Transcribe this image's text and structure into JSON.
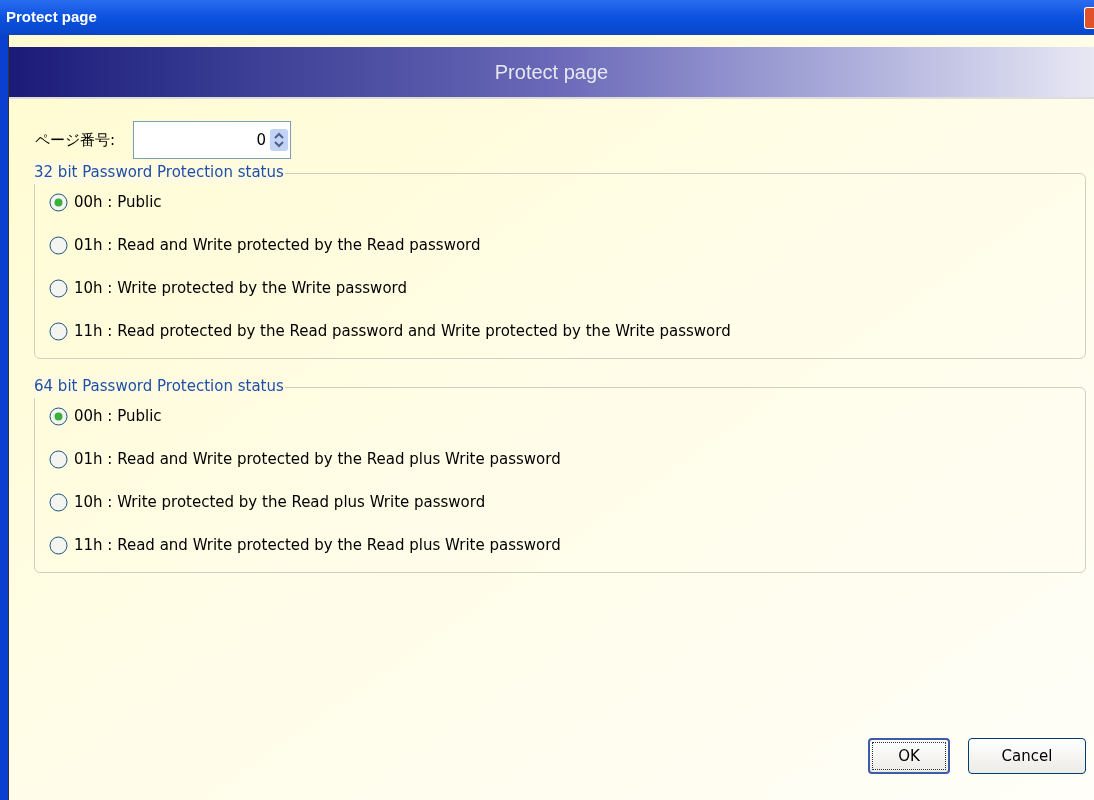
{
  "window": {
    "title": "Protect page"
  },
  "header": {
    "title": "Protect page"
  },
  "page_number": {
    "label": "ページ番号:",
    "value": "0"
  },
  "groups": [
    {
      "title": "32 bit Password Protection status",
      "options": [
        {
          "label": "00h : Public",
          "selected": true
        },
        {
          "label": "01h : Read and Write protected by the Read password",
          "selected": false
        },
        {
          "label": "10h : Write protected by the Write password",
          "selected": false
        },
        {
          "label": "11h : Read protected by the Read password and Write protected by the Write password",
          "selected": false
        }
      ]
    },
    {
      "title": "64 bit Password Protection status",
      "options": [
        {
          "label": "00h : Public",
          "selected": true
        },
        {
          "label": "01h : Read and Write protected by the Read plus Write password",
          "selected": false
        },
        {
          "label": "10h : Write protected by the Read plus Write password",
          "selected": false
        },
        {
          "label": "11h : Read and Write protected by the Read plus Write password",
          "selected": false
        }
      ]
    }
  ],
  "buttons": [
    {
      "label": "OK",
      "kind": "default"
    },
    {
      "label": "Cancel",
      "kind": "normal"
    }
  ]
}
